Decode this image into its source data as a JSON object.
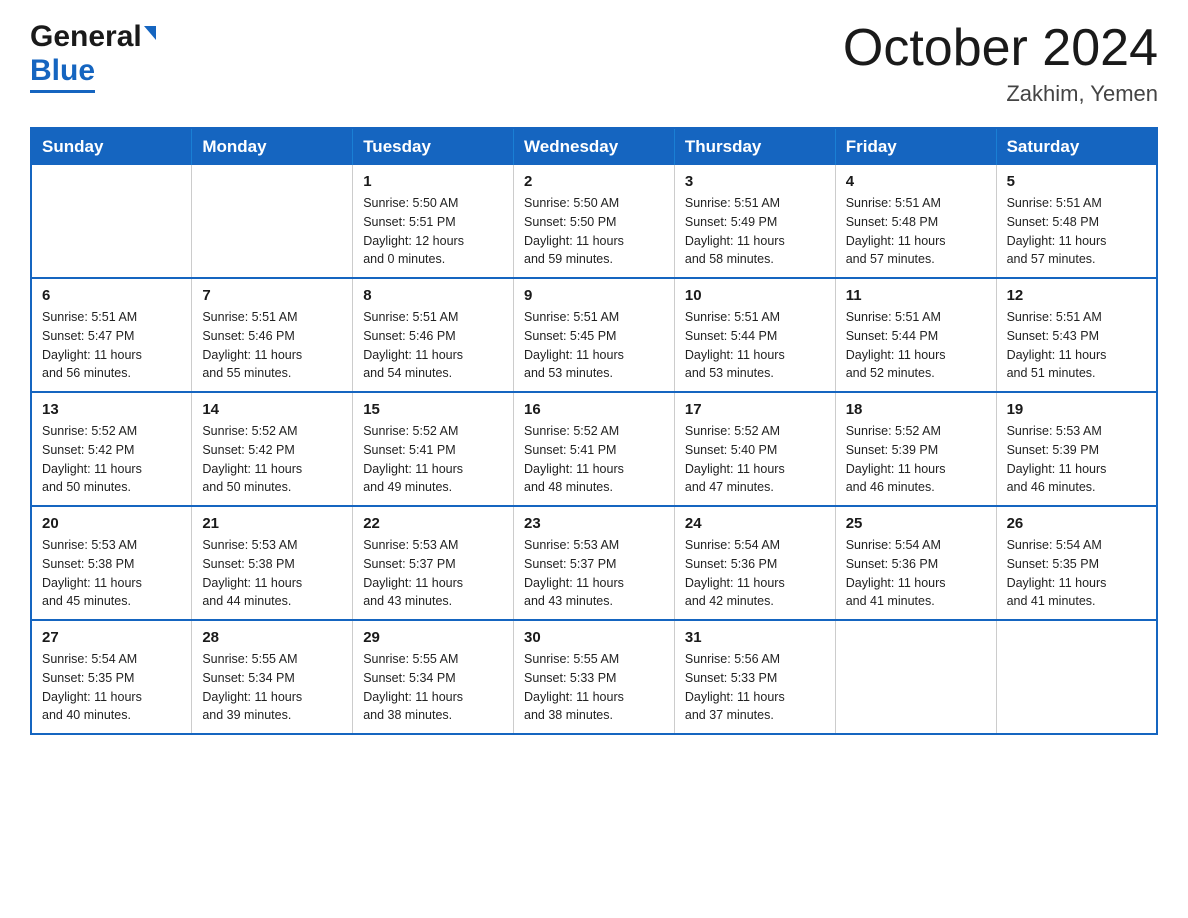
{
  "logo": {
    "general": "General",
    "blue": "Blue"
  },
  "header": {
    "month": "October 2024",
    "location": "Zakhim, Yemen"
  },
  "weekdays": [
    "Sunday",
    "Monday",
    "Tuesday",
    "Wednesday",
    "Thursday",
    "Friday",
    "Saturday"
  ],
  "weeks": [
    [
      {
        "day": "",
        "info": ""
      },
      {
        "day": "",
        "info": ""
      },
      {
        "day": "1",
        "info": "Sunrise: 5:50 AM\nSunset: 5:51 PM\nDaylight: 12 hours\nand 0 minutes."
      },
      {
        "day": "2",
        "info": "Sunrise: 5:50 AM\nSunset: 5:50 PM\nDaylight: 11 hours\nand 59 minutes."
      },
      {
        "day": "3",
        "info": "Sunrise: 5:51 AM\nSunset: 5:49 PM\nDaylight: 11 hours\nand 58 minutes."
      },
      {
        "day": "4",
        "info": "Sunrise: 5:51 AM\nSunset: 5:48 PM\nDaylight: 11 hours\nand 57 minutes."
      },
      {
        "day": "5",
        "info": "Sunrise: 5:51 AM\nSunset: 5:48 PM\nDaylight: 11 hours\nand 57 minutes."
      }
    ],
    [
      {
        "day": "6",
        "info": "Sunrise: 5:51 AM\nSunset: 5:47 PM\nDaylight: 11 hours\nand 56 minutes."
      },
      {
        "day": "7",
        "info": "Sunrise: 5:51 AM\nSunset: 5:46 PM\nDaylight: 11 hours\nand 55 minutes."
      },
      {
        "day": "8",
        "info": "Sunrise: 5:51 AM\nSunset: 5:46 PM\nDaylight: 11 hours\nand 54 minutes."
      },
      {
        "day": "9",
        "info": "Sunrise: 5:51 AM\nSunset: 5:45 PM\nDaylight: 11 hours\nand 53 minutes."
      },
      {
        "day": "10",
        "info": "Sunrise: 5:51 AM\nSunset: 5:44 PM\nDaylight: 11 hours\nand 53 minutes."
      },
      {
        "day": "11",
        "info": "Sunrise: 5:51 AM\nSunset: 5:44 PM\nDaylight: 11 hours\nand 52 minutes."
      },
      {
        "day": "12",
        "info": "Sunrise: 5:51 AM\nSunset: 5:43 PM\nDaylight: 11 hours\nand 51 minutes."
      }
    ],
    [
      {
        "day": "13",
        "info": "Sunrise: 5:52 AM\nSunset: 5:42 PM\nDaylight: 11 hours\nand 50 minutes."
      },
      {
        "day": "14",
        "info": "Sunrise: 5:52 AM\nSunset: 5:42 PM\nDaylight: 11 hours\nand 50 minutes."
      },
      {
        "day": "15",
        "info": "Sunrise: 5:52 AM\nSunset: 5:41 PM\nDaylight: 11 hours\nand 49 minutes."
      },
      {
        "day": "16",
        "info": "Sunrise: 5:52 AM\nSunset: 5:41 PM\nDaylight: 11 hours\nand 48 minutes."
      },
      {
        "day": "17",
        "info": "Sunrise: 5:52 AM\nSunset: 5:40 PM\nDaylight: 11 hours\nand 47 minutes."
      },
      {
        "day": "18",
        "info": "Sunrise: 5:52 AM\nSunset: 5:39 PM\nDaylight: 11 hours\nand 46 minutes."
      },
      {
        "day": "19",
        "info": "Sunrise: 5:53 AM\nSunset: 5:39 PM\nDaylight: 11 hours\nand 46 minutes."
      }
    ],
    [
      {
        "day": "20",
        "info": "Sunrise: 5:53 AM\nSunset: 5:38 PM\nDaylight: 11 hours\nand 45 minutes."
      },
      {
        "day": "21",
        "info": "Sunrise: 5:53 AM\nSunset: 5:38 PM\nDaylight: 11 hours\nand 44 minutes."
      },
      {
        "day": "22",
        "info": "Sunrise: 5:53 AM\nSunset: 5:37 PM\nDaylight: 11 hours\nand 43 minutes."
      },
      {
        "day": "23",
        "info": "Sunrise: 5:53 AM\nSunset: 5:37 PM\nDaylight: 11 hours\nand 43 minutes."
      },
      {
        "day": "24",
        "info": "Sunrise: 5:54 AM\nSunset: 5:36 PM\nDaylight: 11 hours\nand 42 minutes."
      },
      {
        "day": "25",
        "info": "Sunrise: 5:54 AM\nSunset: 5:36 PM\nDaylight: 11 hours\nand 41 minutes."
      },
      {
        "day": "26",
        "info": "Sunrise: 5:54 AM\nSunset: 5:35 PM\nDaylight: 11 hours\nand 41 minutes."
      }
    ],
    [
      {
        "day": "27",
        "info": "Sunrise: 5:54 AM\nSunset: 5:35 PM\nDaylight: 11 hours\nand 40 minutes."
      },
      {
        "day": "28",
        "info": "Sunrise: 5:55 AM\nSunset: 5:34 PM\nDaylight: 11 hours\nand 39 minutes."
      },
      {
        "day": "29",
        "info": "Sunrise: 5:55 AM\nSunset: 5:34 PM\nDaylight: 11 hours\nand 38 minutes."
      },
      {
        "day": "30",
        "info": "Sunrise: 5:55 AM\nSunset: 5:33 PM\nDaylight: 11 hours\nand 38 minutes."
      },
      {
        "day": "31",
        "info": "Sunrise: 5:56 AM\nSunset: 5:33 PM\nDaylight: 11 hours\nand 37 minutes."
      },
      {
        "day": "",
        "info": ""
      },
      {
        "day": "",
        "info": ""
      }
    ]
  ]
}
